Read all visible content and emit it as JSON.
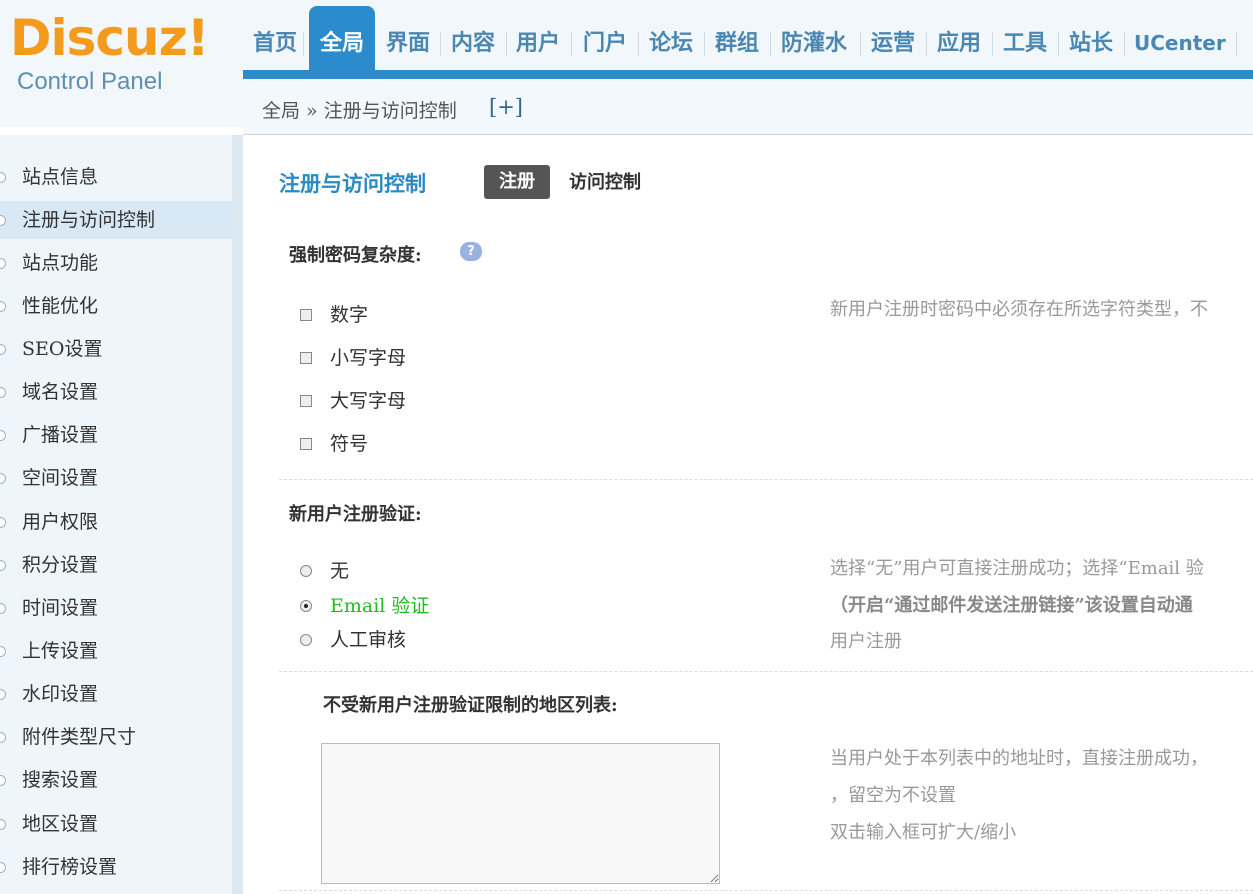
{
  "header": {
    "logo": "Discuz!",
    "logo_sub": "Control Panel",
    "nav": [
      "首页",
      "全局",
      "界面",
      "内容",
      "用户",
      "门户",
      "论坛",
      "群组",
      "防灌水",
      "运营",
      "应用",
      "工具",
      "站长",
      "UCenter"
    ],
    "nav_active": "全局",
    "breadcrumb": "全局 » 注册与访问控制",
    "breadcrumb_plus": "[+]"
  },
  "sidebar": {
    "items": [
      "站点信息",
      "注册与访问控制",
      "站点功能",
      "性能优化",
      "SEO设置",
      "域名设置",
      "广播设置",
      "空间设置",
      "用户权限",
      "积分设置",
      "时间设置",
      "上传设置",
      "水印设置",
      "附件类型尺寸",
      "搜索设置",
      "地区设置",
      "排行榜设置"
    ],
    "active": "注册与访问控制"
  },
  "main": {
    "title": "注册与访问控制",
    "tab_active": "注册",
    "tab_other": "访问控制",
    "password": {
      "label": "强制密码复杂度:",
      "help": "?",
      "options": [
        "数字",
        "小写字母",
        "大写字母",
        "符号"
      ],
      "desc": "新用户注册时密码中必须存在所选字符类型，不"
    },
    "verify": {
      "label": "新用户注册验证:",
      "options": [
        "无",
        "Email 验证",
        "人工审核"
      ],
      "selected": "Email 验证",
      "desc_line1": "选择“无”用户可直接注册成功；选择“Email 验",
      "desc_line2": "（开启“通过邮件发送注册链接”该设置自动通",
      "desc_line3": "用户注册"
    },
    "area": {
      "label": "不受新用户注册验证限制的地区列表:",
      "value": "",
      "desc_line1": "当用户处于本列表中的地址时，直接注册成功，",
      "desc_line2": "，留空为不设置",
      "desc_line3": "双击输入框可扩大/缩小"
    }
  },
  "colors": {
    "accent": "#2c8bcd",
    "logo": "#f49b1e",
    "selected": "#22bb22"
  }
}
